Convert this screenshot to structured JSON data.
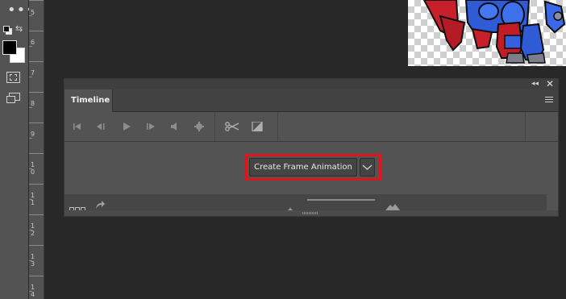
{
  "ruler": {
    "labels": [
      {
        "text": "5"
      },
      {
        "text": "6"
      },
      {
        "text": "7"
      },
      {
        "text": "8"
      },
      {
        "text": "9"
      },
      {
        "text": "10"
      },
      {
        "text": "11"
      },
      {
        "text": "12"
      },
      {
        "text": "13"
      },
      {
        "text": "14"
      }
    ]
  },
  "toolbar": {
    "more_tools": "•••",
    "default_colors_icon": "default-colors-icon",
    "swap_colors_icon": "⇆",
    "foreground_color": "#000000",
    "background_color": "#ffffff",
    "quick_mask_icon": "quick-mask-icon",
    "screen_mode_icon": "screen-mode-icon"
  },
  "panel": {
    "collapse_label": "◂◂",
    "close_label": "✕",
    "tab_title": "Timeline",
    "menu_icon": "panel-menu-icon",
    "controls": [
      {
        "name": "go-to-first-frame-icon"
      },
      {
        "name": "previous-frame-icon"
      },
      {
        "name": "play-icon"
      },
      {
        "name": "next-frame-icon"
      },
      {
        "name": "audio-icon"
      },
      {
        "name": "settings-gear-icon"
      },
      {
        "name": "scissors-icon"
      },
      {
        "name": "transition-icon"
      }
    ],
    "create_button_label": "Create Frame Animation",
    "dropdown_icon": "chevron-down-icon",
    "highlight_color": "#e0141c"
  },
  "footer": {
    "frames_icon": "convert-to-frame-animation-icon",
    "share_icon": "render-video-icon",
    "zoom_out_icon": "zoom-out-mountain-icon",
    "zoom_in_icon": "zoom-in-mountain-icon"
  }
}
